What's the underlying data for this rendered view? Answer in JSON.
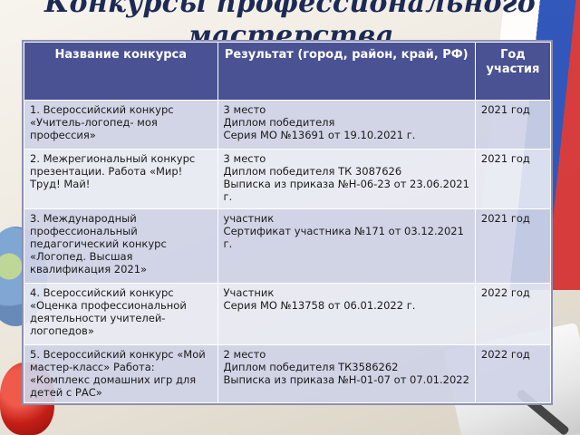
{
  "title": "Конкурсы профессионального мастерства",
  "table": {
    "headers": [
      "Название конкурса",
      "Результат (город, район, край, РФ)",
      "Год участия"
    ],
    "rows": [
      {
        "name": "1. Всероссийский конкурс «Учитель-логопед- моя профессия»",
        "result": [
          "3 место",
          "Диплом победителя",
          "Серия МО №13691 от 19.10.2021 г."
        ],
        "year": "2021 год"
      },
      {
        "name": "2. Межрегиональный конкурс презентации. Работа «Мир! Труд! Май!",
        "result": [
          "3 место",
          "Диплом победителя ТК 3087626",
          "Выписка из приказа №Н-06-23 от 23.06.2021 г."
        ],
        "year": "2021 год"
      },
      {
        "name": "3. Международный профессиональный педагогический конкурс «Логопед. Высшая квалификация 2021»",
        "result": [
          "участник",
          "Сертификат участника №171 от 03.12.2021 г."
        ],
        "year": "2021 год"
      },
      {
        "name": "4. Всероссийский конкурс «Оценка профессиональной деятельности учителей-логопедов»",
        "result": [
          "Участник",
          "Серия МО №13758 от 06.01.2022 г."
        ],
        "year": "2022 год"
      },
      {
        "name": "5. Всероссийский конкурс «Мой мастер-класс» Работа: «Комплекс домашних игр для детей с РАС»",
        "result": [
          "2 место",
          "Диплом победителя ТК3586262",
          "Выписка из приказа №Н-01-07 от 07.01.2022"
        ],
        "year": "2022 год"
      }
    ]
  }
}
